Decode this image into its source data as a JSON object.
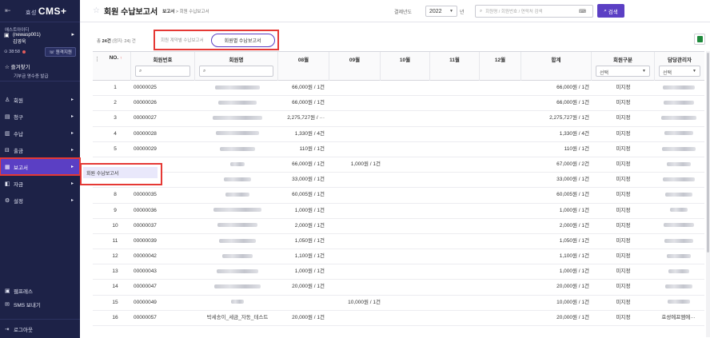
{
  "sidebar": {
    "logo_prefix": "효성",
    "logo_text": "CMS+",
    "company_name": "애스트아이디",
    "company_id": "(newasp001)",
    "user_name": "김영욱",
    "timer": "38:58",
    "remote_support": "원격지원",
    "favorites_title": "즐겨찾기",
    "favorites_sub": "기부금 영수증 발급",
    "menu": [
      {
        "label": "회원",
        "icon": "person-icon"
      },
      {
        "label": "청구",
        "icon": "invoice-icon"
      },
      {
        "label": "수납",
        "icon": "receipt-icon"
      },
      {
        "label": "출금",
        "icon": "withdraw-icon"
      },
      {
        "label": "보고서",
        "icon": "report-icon"
      },
      {
        "label": "자금",
        "icon": "fund-icon"
      },
      {
        "label": "설정",
        "icon": "gear-icon"
      }
    ],
    "bottom": [
      {
        "label": "웹프레스",
        "icon": "web-icon"
      },
      {
        "label": "SMS 보내기",
        "icon": "sms-icon"
      }
    ],
    "logout": "로그아웃",
    "submenu_item": "회원 수납보고서"
  },
  "header": {
    "title": "회원 수납보고서",
    "breadcrumb_root": "보고서",
    "breadcrumb_sep": ">",
    "breadcrumb_current": "회원 수납보고서",
    "year_label": "결제년도",
    "year_value": "2022",
    "year_unit": "년",
    "search_placeholder": "회원명 / 회원번호 / 연락처 검색",
    "search_button": "검색"
  },
  "toolbar": {
    "summary_prefix": "총",
    "summary_count": "24건",
    "summary_suffix": "(정지: 24) 건",
    "tab_inactive": "회원 계약별 수납보고서",
    "tab_active": "회원별 수납보고서"
  },
  "table": {
    "headers": {
      "no": "NO.",
      "sort_mark": "↑",
      "member_no": "회원번호",
      "member_name": "회원명",
      "m08": "08월",
      "m09": "09월",
      "m10": "10월",
      "m11": "11월",
      "m12": "12월",
      "total": "합계",
      "type": "회원구분",
      "manager": "담당관리자"
    },
    "select_placeholder": "선택",
    "rows": [
      {
        "no": "1",
        "id": "00000025",
        "name": "",
        "aug": "66,000원 / 1건",
        "sep": "",
        "total": "66,000원 / 1건",
        "type": "미지정",
        "mgr": ""
      },
      {
        "no": "2",
        "id": "00000026",
        "name": "",
        "aug": "66,000원 / 1건",
        "sep": "",
        "total": "66,000원 / 1건",
        "type": "미지정",
        "mgr": ""
      },
      {
        "no": "3",
        "id": "00000027",
        "name": "",
        "aug": "2,275,727원 / ···",
        "sep": "",
        "total": "2,275,727원 / 1건",
        "type": "미지정",
        "mgr": ""
      },
      {
        "no": "4",
        "id": "00000028",
        "name": "",
        "aug": "1,330원 / 4건",
        "sep": "",
        "total": "1,330원 / 4건",
        "type": "미지정",
        "mgr": ""
      },
      {
        "no": "5",
        "id": "00000029",
        "name": "",
        "aug": "110원 / 1건",
        "sep": "",
        "total": "110원 / 1건",
        "type": "미지정",
        "mgr": ""
      },
      {
        "no": "",
        "id": "",
        "name": "",
        "aug": "66,000원 / 1건",
        "sep": "1,000원 / 1건",
        "total": "67,000원 / 2건",
        "type": "미지정",
        "mgr": ""
      },
      {
        "no": "",
        "id": "",
        "name": "",
        "aug": "33,000원 / 1건",
        "sep": "",
        "total": "33,000원 / 1건",
        "type": "미지정",
        "mgr": ""
      },
      {
        "no": "8",
        "id": "00000035",
        "name": "",
        "aug": "60,005원 / 1건",
        "sep": "",
        "total": "60,005원 / 1건",
        "type": "미지정",
        "mgr": ""
      },
      {
        "no": "9",
        "id": "00000036",
        "name": "",
        "aug": "1,000원 / 1건",
        "sep": "",
        "total": "1,000원 / 1건",
        "type": "미지정",
        "mgr": ""
      },
      {
        "no": "10",
        "id": "00000037",
        "name": "",
        "aug": "2,000원 / 1건",
        "sep": "",
        "total": "2,000원 / 1건",
        "type": "미지정",
        "mgr": ""
      },
      {
        "no": "11",
        "id": "00000039",
        "name": "",
        "aug": "1,050원 / 1건",
        "sep": "",
        "total": "1,050원 / 1건",
        "type": "미지정",
        "mgr": ""
      },
      {
        "no": "12",
        "id": "00000042",
        "name": "",
        "aug": "1,100원 / 1건",
        "sep": "",
        "total": "1,100원 / 1건",
        "type": "미지정",
        "mgr": ""
      },
      {
        "no": "13",
        "id": "00000043",
        "name": "",
        "aug": "1,000원 / 1건",
        "sep": "",
        "total": "1,000원 / 1건",
        "type": "미지정",
        "mgr": ""
      },
      {
        "no": "14",
        "id": "00000047",
        "name": "",
        "aug": "20,000원 / 1건",
        "sep": "",
        "total": "20,000원 / 1건",
        "type": "미지정",
        "mgr": ""
      },
      {
        "no": "15",
        "id": "00000049",
        "name": "",
        "aug": "",
        "sep": "10,000원 / 1건",
        "total": "10,000원 / 1건",
        "type": "미지정",
        "mgr": ""
      },
      {
        "no": "16",
        "id": "00000057",
        "name": "박세송이_세금_자동_테스트",
        "aug": "20,000원 / 1건",
        "sep": "",
        "total": "20,000원 / 1건",
        "type": "미지정",
        "mgr": "효성에프엠에···"
      }
    ]
  },
  "colors": {
    "sidebar_bg": "#1d2247",
    "accent": "#5b3fc4",
    "highlight": "#e53935"
  }
}
